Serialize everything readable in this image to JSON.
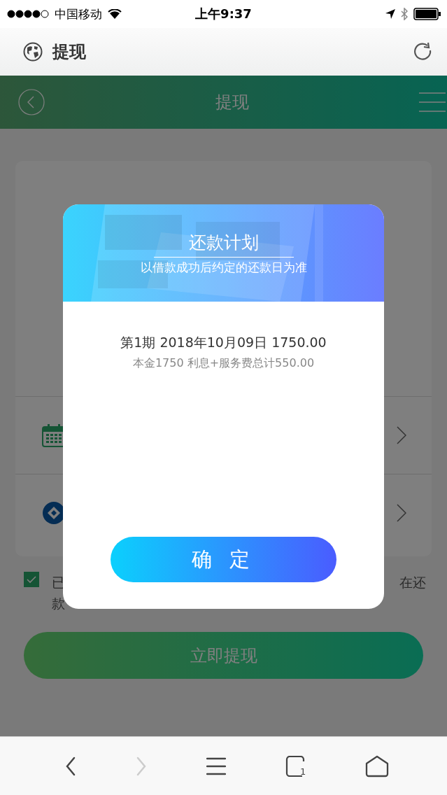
{
  "status_bar": {
    "carrier": "中国移动",
    "time": "上午9:37"
  },
  "browser": {
    "title": "提现",
    "tab_count": "1",
    "back_disabled": false,
    "forward_disabled": true
  },
  "app_header": {
    "title": "提现"
  },
  "background_card": {
    "rows": [
      {
        "kind": "calendar"
      },
      {
        "kind": "bank"
      }
    ]
  },
  "agreement": {
    "checked": true,
    "visible_text": [
      "已",
      "在还",
      "款"
    ]
  },
  "withdraw_button": {
    "label": "立即提现"
  },
  "dialog": {
    "title": "还款计划",
    "subtitle": "以借款成功后约定的还款日为准",
    "installments": [
      {
        "line": "第1期 2018年10月09日 1750.00",
        "detail": "本金1750 利息+服务费总计550.00"
      }
    ],
    "confirm": "确 定"
  }
}
